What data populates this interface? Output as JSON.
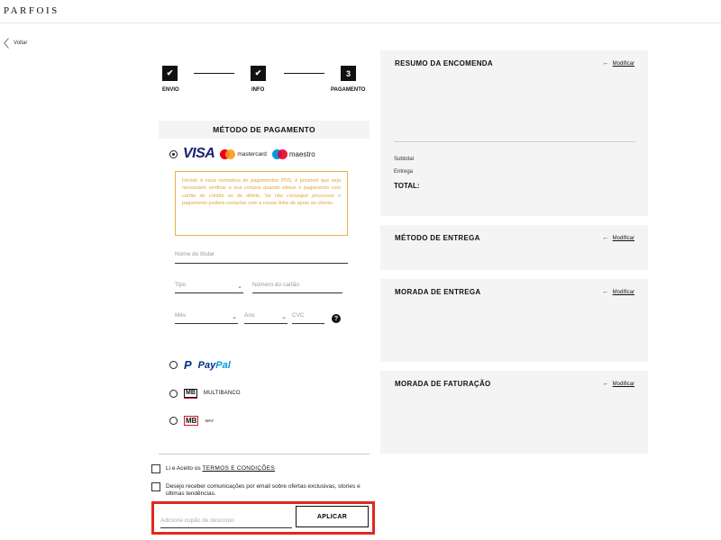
{
  "brand": {
    "logo": "PARFOIS"
  },
  "nav": {
    "back_label": "Voltar"
  },
  "stepper": {
    "steps": [
      {
        "label": "ENVIO",
        "mark": "✔",
        "state": "done"
      },
      {
        "label": "INFO",
        "mark": "✔",
        "state": "done"
      },
      {
        "label": "PAGAMENTO",
        "mark": "3",
        "state": "current"
      }
    ]
  },
  "payment": {
    "title": "MÉTODO DE PAGAMENTO",
    "card": {
      "selected": true,
      "brands": {
        "visa": "VISA",
        "mastercard": "mastercard",
        "maestro": "maestro"
      },
      "notice": "Devido à nova normativa de pagamentos PDS, é possível que seja necessário verificar a sua compra quando efetue o pagamento com cartão de crédito ou de débito. Se não conseguir processar o pagamento poderá contactar com a nossa linha de apoio ao cliente.",
      "fields": {
        "holder_placeholder": "Nome do titular",
        "type_placeholder": "Tipo",
        "number_placeholder": "Número do cartão",
        "month_placeholder": "Mês",
        "year_placeholder": "Ano",
        "cvc_placeholder": "CVC",
        "help_glyph": "?"
      }
    },
    "alternatives": {
      "paypal": {
        "pay": "Pay",
        "pal": "Pal",
        "selected": false
      },
      "multibanco": {
        "mark": "MB",
        "label": "MULTIBANCO",
        "selected": false
      },
      "mbway": {
        "mark": "MB",
        "label": "WAY",
        "selected": false
      }
    }
  },
  "consent": {
    "terms_prefix": "Li e Aceito os",
    "terms_link": "TERMOS E CONDIÇÕES",
    "newsletter": "Desejo receber comunicações por email sobre ofertas exclusivas, stories e últimas tendências."
  },
  "coupon": {
    "placeholder": "Adicione cupão de desconto",
    "apply_label": "APLICAR"
  },
  "summary": {
    "title": "RESUMO DA ENCOMENDA",
    "modify_label": "Modificar",
    "subtotal_label": "Subtotal",
    "delivery_label": "Entrega",
    "total_label": "TOTAL:"
  },
  "delivery_method": {
    "title": "MÉTODO DE ENTREGA",
    "modify_label": "Modificar"
  },
  "shipping_address": {
    "title": "MORADA DE ENTREGA",
    "modify_label": "Modificar"
  },
  "billing_address": {
    "title": "MORADA DE FATURAÇÃO",
    "modify_label": "Modificar"
  },
  "colors": {
    "notice": "#e3a43a",
    "highlight": "#e0291d",
    "visa": "#1a1f71",
    "paypal_dark": "#003087",
    "paypal_light": "#009cde"
  }
}
